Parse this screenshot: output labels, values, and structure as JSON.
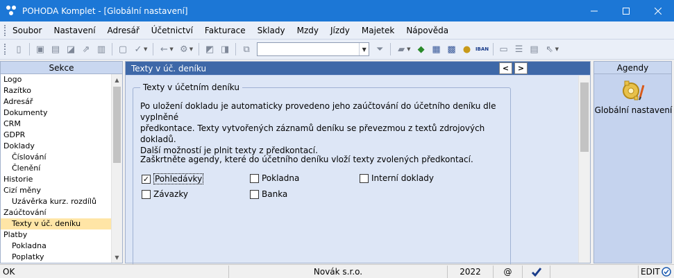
{
  "window": {
    "title": "POHODA Komplet - [Globální nastavení]",
    "controls": [
      "minimize",
      "maximize",
      "close"
    ]
  },
  "menu": {
    "items": [
      "Soubor",
      "Nastavení",
      "Adresář",
      "Účetnictví",
      "Fakturace",
      "Sklady",
      "Mzdy",
      "Jízdy",
      "Majetek",
      "Nápověda"
    ]
  },
  "toolbar": {
    "search_value": "",
    "icons": [
      "open-record-icon",
      "copy-icon",
      "print-icon",
      "print-preview-icon",
      "export-icon",
      "report-icon",
      "note-icon",
      "brush-icon",
      "back-icon",
      "gear-icon",
      "save-icon",
      "save-all-icon",
      "copy-doc-icon",
      "filter-icon",
      "folder-icon",
      "tag-icon",
      "calculator-icon",
      "calc2-icon",
      "coins-icon",
      "iban-icon",
      "message-icon",
      "list-icon",
      "list2-icon",
      "help-pointer-icon"
    ],
    "iban_label": "IBAN"
  },
  "sidebar": {
    "header": "Sekce",
    "items": [
      {
        "label": "Logo",
        "level": 0
      },
      {
        "label": "Razítko",
        "level": 0
      },
      {
        "label": "Adresář",
        "level": 0
      },
      {
        "label": "Dokumenty",
        "level": 0
      },
      {
        "label": "CRM",
        "level": 0
      },
      {
        "label": "GDPR",
        "level": 0
      },
      {
        "label": "Doklady",
        "level": 0
      },
      {
        "label": "Číslování",
        "level": 1
      },
      {
        "label": "Členění",
        "level": 1
      },
      {
        "label": "Historie",
        "level": 0
      },
      {
        "label": "Cizí měny",
        "level": 0
      },
      {
        "label": "Uzávěrka kurz. rozdílů",
        "level": 1
      },
      {
        "label": "Zaúčtování",
        "level": 0
      },
      {
        "label": "Texty v úč. deníku",
        "level": 1,
        "selected": true
      },
      {
        "label": "Platby",
        "level": 0
      },
      {
        "label": "Pokladna",
        "level": 1
      },
      {
        "label": "Poplatky",
        "level": 1
      }
    ]
  },
  "main": {
    "tab_title": "Texty v úč. deníku",
    "prev_symbol": "<",
    "next_symbol": ">",
    "group_title": "Texty v účetním deníku",
    "paragraph1": [
      "Po uložení dokladu je automaticky provedeno jeho zaúčtování do účetního deníku dle vyplněné",
      "předkontace. Texty vytvořených záznamů deníku se převezmou z textů zdrojových dokladů.",
      "Další možností je plnit texty z předkontací."
    ],
    "paragraph2": "Zaškrtněte agendy, které do účetního deníku vloží texty zvolených předkontací.",
    "checkboxes": [
      {
        "label": "Pohledávky",
        "checked": true
      },
      {
        "label": "Pokladna",
        "checked": false
      },
      {
        "label": "Interní doklady",
        "checked": false
      },
      {
        "label": "Závazky",
        "checked": false
      },
      {
        "label": "Banka",
        "checked": false
      }
    ]
  },
  "agendy": {
    "header": "Agendy",
    "item_label": "Globální nastavení"
  },
  "status": {
    "state": "OK",
    "company": "Novák s.r.o.",
    "year": "2022",
    "at": "@",
    "mode": "EDIT"
  }
}
